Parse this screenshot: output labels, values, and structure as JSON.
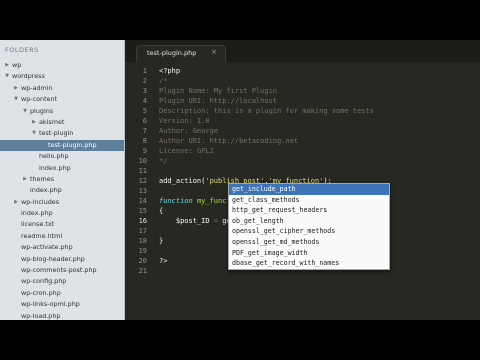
{
  "sidebar": {
    "header": "FOLDERS",
    "tree": [
      {
        "label": "wp",
        "depth": 0,
        "arrow": "right",
        "selected": false
      },
      {
        "label": "wordpress",
        "depth": 0,
        "arrow": "down",
        "selected": false
      },
      {
        "label": "wp-admin",
        "depth": 1,
        "arrow": "right",
        "selected": false
      },
      {
        "label": "wp-content",
        "depth": 1,
        "arrow": "down",
        "selected": false
      },
      {
        "label": "plugins",
        "depth": 2,
        "arrow": "down",
        "selected": false
      },
      {
        "label": "akismet",
        "depth": 3,
        "arrow": "right",
        "selected": false
      },
      {
        "label": "test-plugin",
        "depth": 3,
        "arrow": "down",
        "selected": false
      },
      {
        "label": "test-plugin.php",
        "depth": 4,
        "arrow": "",
        "selected": true
      },
      {
        "label": "hello.php",
        "depth": 3,
        "arrow": "",
        "selected": false
      },
      {
        "label": "index.php",
        "depth": 3,
        "arrow": "",
        "selected": false
      },
      {
        "label": "themes",
        "depth": 2,
        "arrow": "right",
        "selected": false
      },
      {
        "label": "index.php",
        "depth": 2,
        "arrow": "",
        "selected": false
      },
      {
        "label": "wp-includes",
        "depth": 1,
        "arrow": "right",
        "selected": false
      },
      {
        "label": "index.php",
        "depth": 1,
        "arrow": "",
        "selected": false
      },
      {
        "label": "license.txt",
        "depth": 1,
        "arrow": "",
        "selected": false
      },
      {
        "label": "readme.html",
        "depth": 1,
        "arrow": "",
        "selected": false
      },
      {
        "label": "wp-activate.php",
        "depth": 1,
        "arrow": "",
        "selected": false
      },
      {
        "label": "wp-blog-header.php",
        "depth": 1,
        "arrow": "",
        "selected": false
      },
      {
        "label": "wp-comments-post.php",
        "depth": 1,
        "arrow": "",
        "selected": false
      },
      {
        "label": "wp-config.php",
        "depth": 1,
        "arrow": "",
        "selected": false
      },
      {
        "label": "wp-cron.php",
        "depth": 1,
        "arrow": "",
        "selected": false
      },
      {
        "label": "wp-links-opml.php",
        "depth": 1,
        "arrow": "",
        "selected": false
      },
      {
        "label": "wp-load.php",
        "depth": 1,
        "arrow": "",
        "selected": false
      },
      {
        "label": "wp-login.php",
        "depth": 1,
        "arrow": "",
        "selected": false
      }
    ]
  },
  "tab": {
    "label": "test-plugin.php",
    "close": "×"
  },
  "editor": {
    "active_line": 16,
    "lines": [
      {
        "n": 1,
        "tokens": [
          {
            "t": "<?php",
            "c": "tag"
          }
        ]
      },
      {
        "n": 2,
        "tokens": [
          {
            "t": "/*",
            "c": "com"
          }
        ]
      },
      {
        "n": 3,
        "tokens": [
          {
            "t": "Plugin Name: My first Plugin",
            "c": "com"
          }
        ]
      },
      {
        "n": 4,
        "tokens": [
          {
            "t": "Plugin URI: http://localhost",
            "c": "com"
          }
        ]
      },
      {
        "n": 5,
        "tokens": [
          {
            "t": "Description: this is a plugin for making some tests",
            "c": "com"
          }
        ]
      },
      {
        "n": 6,
        "tokens": [
          {
            "t": "Version: 1.0",
            "c": "com"
          }
        ]
      },
      {
        "n": 7,
        "tokens": [
          {
            "t": "Author: George",
            "c": "com"
          }
        ]
      },
      {
        "n": 8,
        "tokens": [
          {
            "t": "Author URI: http://betacoding.net",
            "c": "com"
          }
        ]
      },
      {
        "n": 9,
        "tokens": [
          {
            "t": "License: GPL2",
            "c": "com"
          }
        ]
      },
      {
        "n": 10,
        "tokens": [
          {
            "t": "*/",
            "c": "com"
          }
        ]
      },
      {
        "n": 11,
        "tokens": []
      },
      {
        "n": 12,
        "tokens": [
          {
            "t": "add_action(",
            "c": "pl"
          },
          {
            "t": "'publish_post'",
            "c": "str"
          },
          {
            "t": ",",
            "c": "pl"
          },
          {
            "t": "'my_function'",
            "c": "str"
          },
          {
            "t": ");",
            "c": "pl"
          }
        ]
      },
      {
        "n": 13,
        "tokens": []
      },
      {
        "n": 14,
        "tokens": [
          {
            "t": "function",
            "c": "kw"
          },
          {
            "t": " ",
            "c": "pl"
          },
          {
            "t": "my_function",
            "c": "fn"
          },
          {
            "t": "()",
            "c": "pl"
          }
        ]
      },
      {
        "n": 15,
        "tokens": [
          {
            "t": "{",
            "c": "pl"
          }
        ]
      },
      {
        "n": 16,
        "tokens": [
          {
            "t": "    $post_ID ",
            "c": "pl"
          },
          {
            "t": "=",
            "c": "op"
          },
          {
            "t": " get_th",
            "c": "pl"
          }
        ],
        "caret": true
      },
      {
        "n": 17,
        "tokens": []
      },
      {
        "n": 18,
        "tokens": [
          {
            "t": "}",
            "c": "pl"
          }
        ]
      },
      {
        "n": 19,
        "tokens": []
      },
      {
        "n": 20,
        "tokens": [
          {
            "t": "?>",
            "c": "tag"
          }
        ]
      },
      {
        "n": 21,
        "tokens": []
      }
    ]
  },
  "autocomplete": {
    "selected_index": 0,
    "items": [
      "get_include_path",
      "get_class_methods",
      "http_get_request_headers",
      "ob_get_length",
      "openssl_get_cipher_methods",
      "openssl_get_md_methods",
      "PDF_get_image_width",
      "dbase_get_record_with_names"
    ]
  }
}
